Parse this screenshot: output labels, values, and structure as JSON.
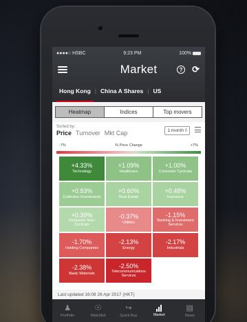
{
  "status_bar": {
    "carrier": "●●●●○ HSBC",
    "time": "9:23 PM",
    "battery": "100%"
  },
  "header": {
    "title": "Market",
    "menu_icon": "hamburger-icon",
    "help_icon": "?",
    "refresh_icon": "⟳"
  },
  "market_tabs": [
    {
      "label": "Hong Kong",
      "active": true
    },
    {
      "label": "China A Shares",
      "active": false
    },
    {
      "label": "US",
      "active": false
    }
  ],
  "view_segments": [
    {
      "label": "Heatmap",
      "active": true
    },
    {
      "label": "Indices",
      "active": false
    },
    {
      "label": "Top movers",
      "active": false
    }
  ],
  "sort": {
    "label": "Sorted by:",
    "options": [
      {
        "label": "Price",
        "active": true
      },
      {
        "label": "Turnover",
        "active": false
      },
      {
        "label": "Mkt Cap",
        "active": false
      }
    ],
    "period": "1 month ◊"
  },
  "scale": {
    "min": "-7%",
    "title": "% Price Change",
    "max": "+7%"
  },
  "colors": {
    "dark_green": "#3f8a3a",
    "mid_green": "#7cb576",
    "light_green": "#a9d3a1",
    "light_red": "#e47373",
    "mid_red": "#d94545",
    "dark_red": "#c9262b",
    "hsbc_red": "#db0011"
  },
  "heatmap": [
    {
      "change": "+4.33%",
      "sector": "Technology",
      "color": "#3f8a3a"
    },
    {
      "change": "+1.09%",
      "sector": "Healthcare",
      "color": "#8fc286"
    },
    {
      "change": "+1.00%",
      "sector": "Consumer Cyclicals",
      "color": "#8fc286"
    },
    {
      "change": "+0.93%",
      "sector": "Collective Investments",
      "color": "#9ccb94"
    },
    {
      "change": "+0.60%",
      "sector": "Real Estate",
      "color": "#a9d3a1"
    },
    {
      "change": "+0.48%",
      "sector": "Insurance",
      "color": "#a9d3a1"
    },
    {
      "change": "+0.39%",
      "sector": "Consumer Non-Cyclicals",
      "color": "#b4d9ad"
    },
    {
      "change": "-0.37%",
      "sector": "Utilities",
      "color": "#e88a8a"
    },
    {
      "change": "-1.15%",
      "sector": "Banking & Investment Services",
      "color": "#e06b6b"
    },
    {
      "change": "-1.70%",
      "sector": "Holding Companies",
      "color": "#dd5b5b"
    },
    {
      "change": "-2.13%",
      "sector": "Energy",
      "color": "#d44343"
    },
    {
      "change": "-2.17%",
      "sector": "Industrials",
      "color": "#d44343"
    },
    {
      "change": "-2.38%",
      "sector": "Basic Materials",
      "color": "#ce3636"
    },
    {
      "change": "-2.50%",
      "sector": "Telecommunications Services",
      "color": "#c9262b"
    }
  ],
  "last_updated": "Last updated 16:08 26 Apr 2017 (HKT)",
  "bottom_nav": [
    {
      "label": "Portfolio",
      "icon": "person-icon",
      "active": false
    },
    {
      "label": "Watchlist",
      "icon": "eye-icon",
      "active": false
    },
    {
      "label": "Quick Buy",
      "icon": "quick-buy-icon",
      "active": false
    },
    {
      "label": "Market",
      "icon": "bar-chart-icon",
      "active": true
    },
    {
      "label": "News",
      "icon": "news-icon",
      "active": false
    }
  ]
}
